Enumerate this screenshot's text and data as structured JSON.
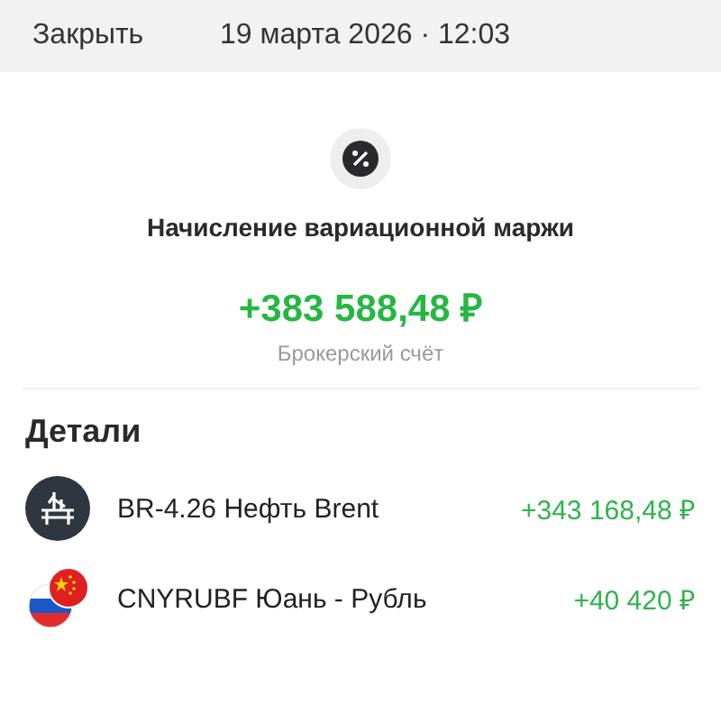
{
  "header": {
    "close": "Закрыть",
    "datetime": "19 марта 2026 · 12:03"
  },
  "operation": {
    "title": "Начисление вариационной маржи",
    "amount": "+383 588,48 ₽",
    "account": "Брокерский счёт"
  },
  "details": {
    "title": "Детали",
    "items": [
      {
        "kind": "oil",
        "name": "BR-4.26 Нефть Brent",
        "amount": "+343 168,48 ₽"
      },
      {
        "kind": "currency-pair",
        "name": "CNYRUBF Юань - Рубль",
        "amount": "+40 420 ₽"
      }
    ]
  }
}
